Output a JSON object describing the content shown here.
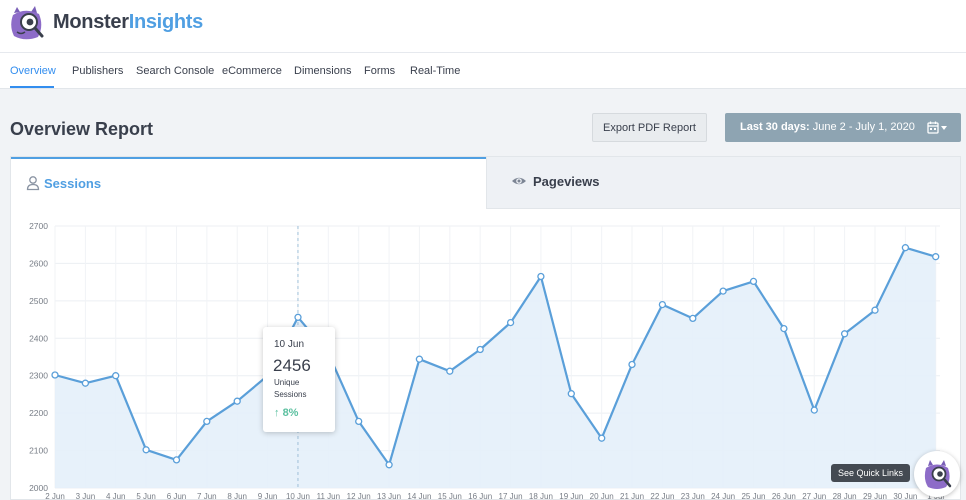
{
  "brand": {
    "name_part1": "Monster",
    "name_part2": "Insights"
  },
  "nav": {
    "items": [
      {
        "label": "Overview",
        "active": true
      },
      {
        "label": "Publishers",
        "active": false
      },
      {
        "label": "Search Console",
        "active": false
      },
      {
        "label": "eCommerce",
        "active": false
      },
      {
        "label": "Dimensions",
        "active": false
      },
      {
        "label": "Forms",
        "active": false
      },
      {
        "label": "Real-Time",
        "active": false
      }
    ]
  },
  "header": {
    "title": "Overview Report",
    "export_label": "Export PDF Report",
    "date_range_prefix": "Last 30 days:",
    "date_range_value": " June 2 - July 1, 2020"
  },
  "tabs": {
    "sessions": "Sessions",
    "pageviews": "Pageviews"
  },
  "tooltip": {
    "date": "10 Jun",
    "value": "2456",
    "label": "Unique Sessions",
    "change": "8%"
  },
  "quick_links": {
    "label": "See Quick Links"
  },
  "colors": {
    "accent": "#509fe2",
    "line": "#5a9fd9",
    "fill": "#e4effa",
    "positive": "#5cc0a0",
    "date_button": "#8ea4b2"
  },
  "chart_data": {
    "type": "area",
    "series": [
      {
        "name": "Unique Sessions"
      }
    ],
    "x": [
      "2 Jun",
      "3 Jun",
      "4 Jun",
      "5 Jun",
      "6 Jun",
      "7 Jun",
      "8 Jun",
      "9 Jun",
      "10 Jun",
      "11 Jun",
      "12 Jun",
      "13 Jun",
      "14 Jun",
      "15 Jun",
      "16 Jun",
      "17 Jun",
      "18 Jun",
      "19 Jun",
      "20 Jun",
      "21 Jun",
      "22 Jun",
      "23 Jun",
      "24 Jun",
      "25 Jun",
      "26 Jun",
      "27 Jun",
      "28 Jun",
      "29 Jun",
      "30 Jun",
      "1 Jul"
    ],
    "values": [
      2302,
      2280,
      2300,
      2102,
      2075,
      2178,
      2232,
      2300,
      2456,
      2360,
      2178,
      2062,
      2344,
      2312,
      2370,
      2442,
      2565,
      2252,
      2133,
      2330,
      2490,
      2453,
      2526,
      2552,
      2426,
      2208,
      2412,
      2475,
      2642,
      2618
    ],
    "yticks": [
      2000,
      2100,
      2200,
      2300,
      2400,
      2500,
      2600,
      2700
    ],
    "ylim": [
      2000,
      2700
    ],
    "grid": true,
    "highlight": "10 Jun"
  }
}
